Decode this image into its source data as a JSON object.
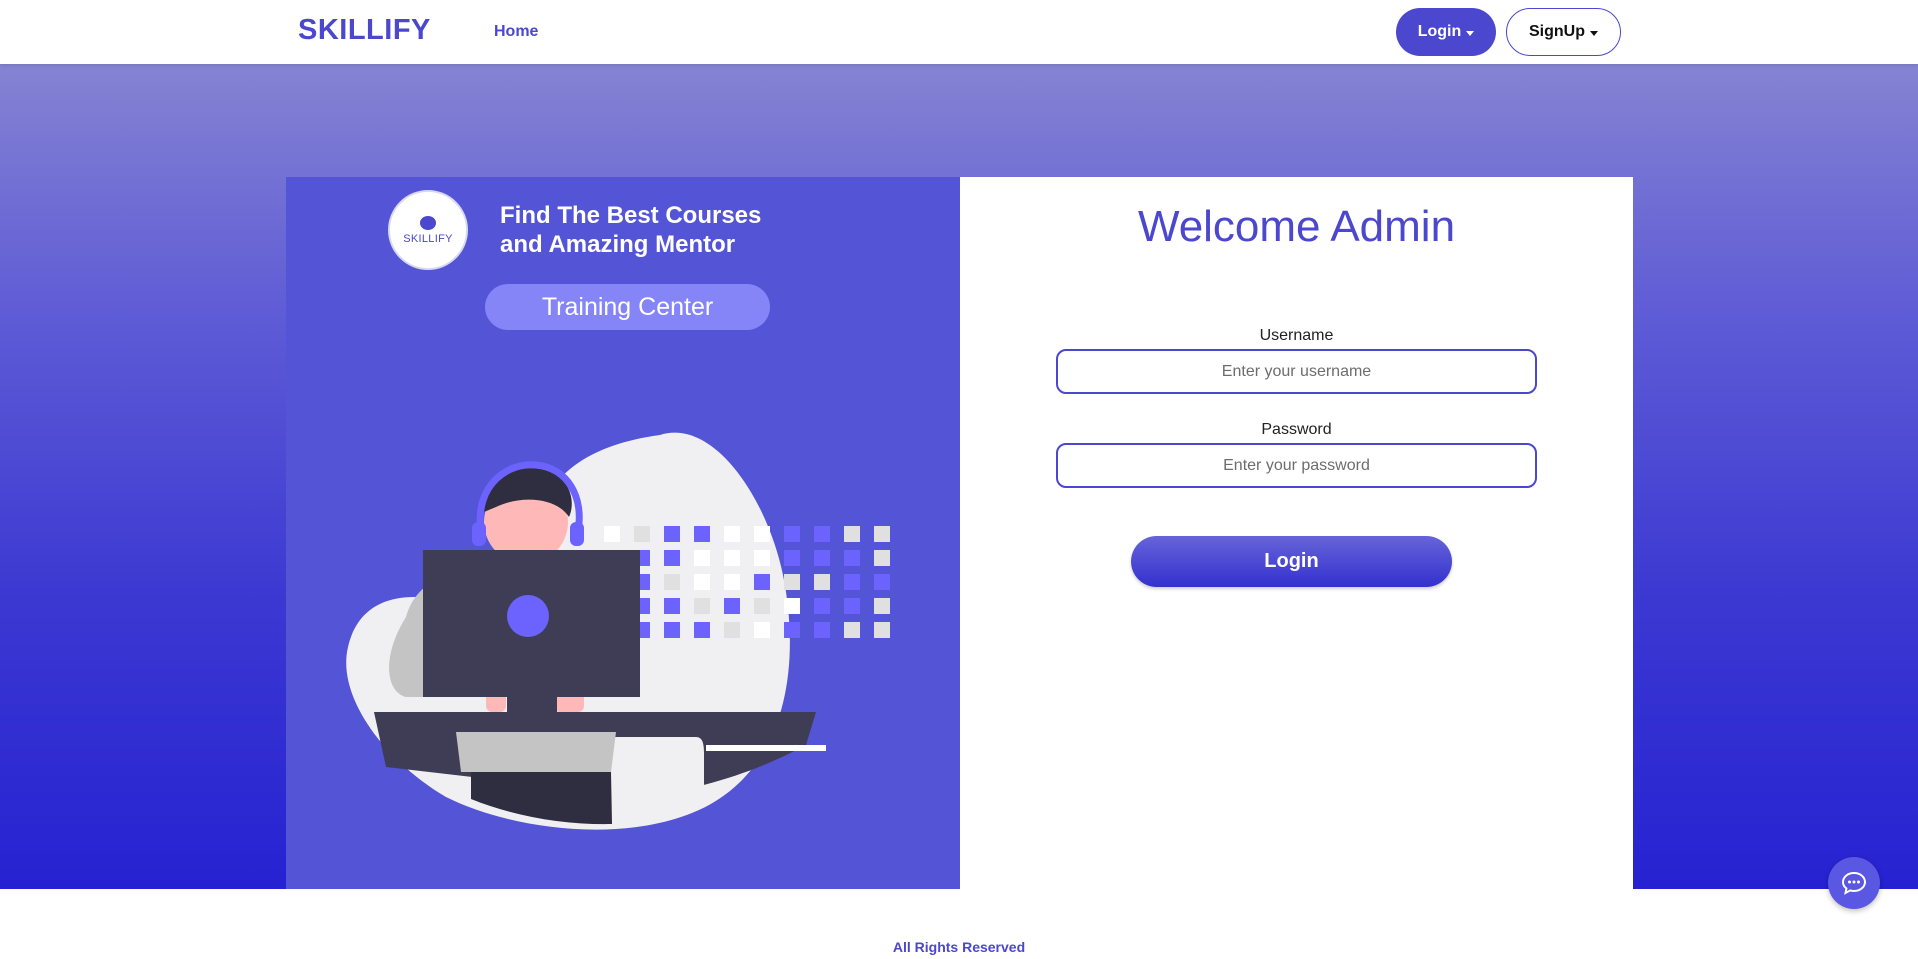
{
  "navbar": {
    "brand": "SKILLIFY",
    "home_link": "Home",
    "login_label": "Login",
    "signup_label": "SignUp"
  },
  "promo": {
    "logo_text": "SKILLIFY",
    "tagline_line1": "Find The Best Courses",
    "tagline_line2": "and Amazing Mentor",
    "badge": "Training Center"
  },
  "login_form": {
    "heading": "Welcome Admin",
    "username_label": "Username",
    "username_placeholder": "Enter your username",
    "username_value": "",
    "password_label": "Password",
    "password_placeholder": "Enter your password",
    "password_value": "",
    "submit_label": "Login"
  },
  "footer": {
    "text": "All Rights Reserved"
  },
  "colors": {
    "accent": "#4b47cf",
    "panel": "#5454d6",
    "badge": "#8585f7",
    "background_bottom": "#2622d2"
  },
  "icons": {
    "chat": "chat-bubble-icon",
    "caret": "chevron-down-icon"
  }
}
